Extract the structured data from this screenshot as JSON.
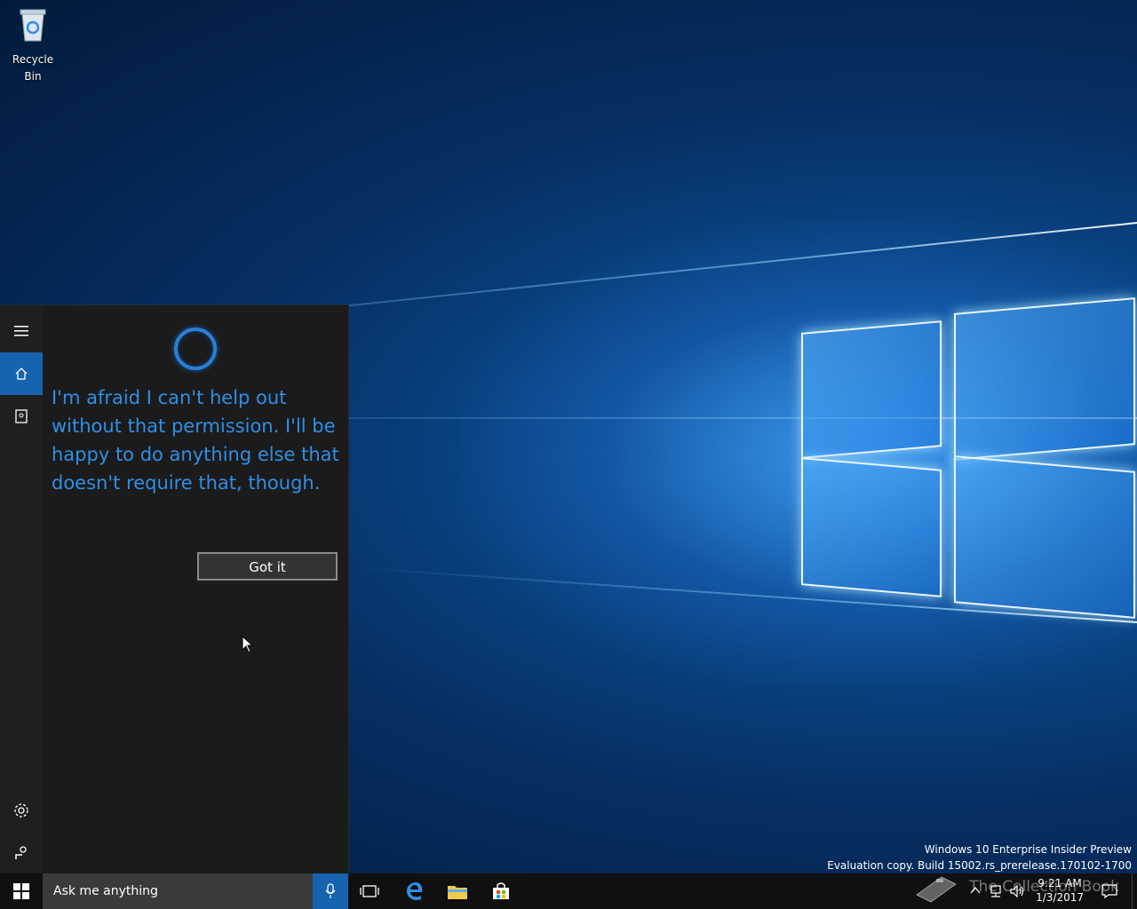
{
  "desktop": {
    "icons": [
      {
        "label": "Recycle Bin",
        "icon": "recycle-bin-icon"
      }
    ],
    "watermark": {
      "line1": "Windows 10 Enterprise Insider Preview",
      "line2": "Evaluation copy. Build 15002.rs_prerelease.170102-1700"
    }
  },
  "cortana": {
    "rail": {
      "items": [
        "hamburger-icon",
        "home-icon",
        "notebook-icon"
      ],
      "bottom": [
        "settings-icon",
        "feedback-icon"
      ]
    },
    "message": "I'm afraid I can't help out without that permission. I'll be happy to do anything else that doesn't require that, though.",
    "button_label": "Got it",
    "accent": "#1664b0",
    "text_color": "#2f8fe6"
  },
  "taskbar": {
    "search_placeholder": "Ask me anything",
    "pinned": [
      "task-view-icon",
      "edge-icon",
      "file-explorer-icon",
      "store-icon"
    ],
    "time": "9:21 AM",
    "date": "1/3/2017",
    "overlay_text": "The Collection Book"
  }
}
